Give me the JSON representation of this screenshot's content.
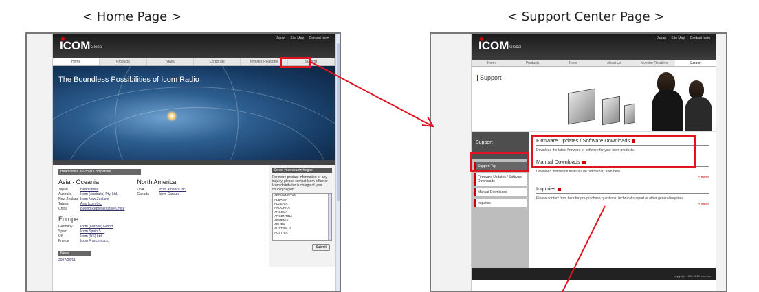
{
  "captions": {
    "home": "< Home Page >",
    "support": "< Support Center Page >"
  },
  "home": {
    "logo": "ICOM",
    "logo_sub": "Global",
    "top_links": [
      "Japan",
      "Site Map",
      "Contact Icom"
    ],
    "nav": [
      "Home",
      "Products",
      "News",
      "Corporate",
      "Investor Relations",
      "Support"
    ],
    "hero_title": "The Boundless Possibilities of Icom Radio",
    "head_office_bar": "Head Office & Group Companies",
    "asia_title": "Asia · Oceania",
    "asia_rows": [
      {
        "country": "Japan",
        "office": "Head Office"
      },
      {
        "country": "Australia",
        "office": "Icom (Australia) Pty. Ltd."
      },
      {
        "country": "New Zealand",
        "office": "Icom New Zealand"
      },
      {
        "country": "Taiwan",
        "office": "Asia Icom Inc."
      },
      {
        "country": "China",
        "office": "Beijing Representative Office"
      }
    ],
    "na_title": "North America",
    "na_rows": [
      {
        "country": "USA",
        "office": "Icom America Inc."
      },
      {
        "country": "Canada",
        "office": "Icom Canada"
      }
    ],
    "europe_title": "Europe",
    "europe_rows": [
      {
        "country": "Germany",
        "office": "Icom (Europe) GmbH"
      },
      {
        "country": "Spain",
        "office": "Icom Spain S.L."
      },
      {
        "country": "UK",
        "office": "Icom (UK) Ltd."
      },
      {
        "country": "France",
        "office": "Icom France s.a.s."
      }
    ],
    "news_bar": "News",
    "news_date": "2007/08/11",
    "side_title": "Select your country/region",
    "side_text": "For more product information or any inquiry, please contact Icom office or Icom distributor in charge of your country/region.",
    "countries": [
      "AFGHANISTAN",
      "ALBANIA",
      "ALGERIA",
      "ANDORRA",
      "ANGOLA",
      "ARGENTINA",
      "ARMENIA",
      "ARUBA",
      "AUSTRALIA",
      "AUSTRIA"
    ],
    "submit": "Submit"
  },
  "support": {
    "logo": "ICOM",
    "logo_sub": "Global",
    "top_links": [
      "Japan",
      "Site Map",
      "Contact Icom"
    ],
    "nav": [
      "Home",
      "Products",
      "News",
      "About Us",
      "Investor Relations",
      "Support"
    ],
    "page_title": "Support",
    "left_head": "Support",
    "left_items": [
      "Support Top",
      "Firmware Updates / Software Downloads",
      "Manual Downloads",
      "Inquiries"
    ],
    "sections": [
      {
        "title": "Firmware Updates / Software Downloads",
        "desc": "Download the latest firmware or software for your Icom products.",
        "more": ""
      },
      {
        "title": "Manual Downloads",
        "desc": "Download instruction manuals (in pdf format) from here.",
        "more": "> more"
      },
      {
        "title": "Inquiries",
        "desc": "Please contact from here for pre-purchase questions, technical support or other general inquiries.",
        "more": "> more"
      }
    ],
    "footer": "copyright 1996-2008 Icom Inc."
  },
  "colors": {
    "highlight": "#e0141e",
    "accent": "#cc0000"
  }
}
